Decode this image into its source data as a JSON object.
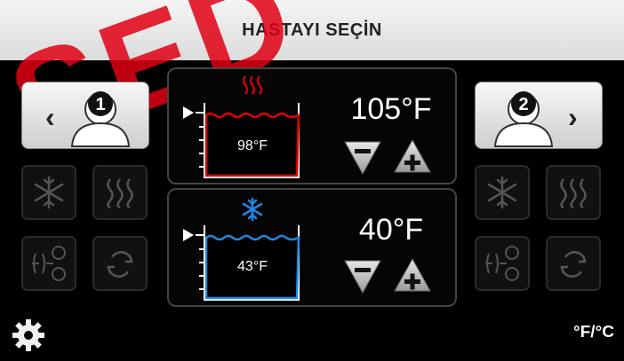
{
  "header": {
    "title": "HASTAYI SEÇİN"
  },
  "watermark": {
    "text": "SED"
  },
  "patients": [
    {
      "number": "1",
      "arrow": "‹"
    },
    {
      "number": "2",
      "arrow": "›"
    }
  ],
  "channels": [
    {
      "mode": "heat",
      "current": "98°F",
      "setpoint": "105°F",
      "color": "#e00000"
    },
    {
      "mode": "cool",
      "current": "43°F",
      "setpoint": "40°F",
      "color": "#1e88e5"
    }
  ],
  "icons": {
    "cool_mode": "snowflake-icon",
    "heat_mode": "heat-waves-icon",
    "gradient_mode": "gradient-icon",
    "auto_cycle_mode": "cycle-icon",
    "settings": "gear-icon"
  },
  "units": {
    "label": "°F/°C"
  }
}
